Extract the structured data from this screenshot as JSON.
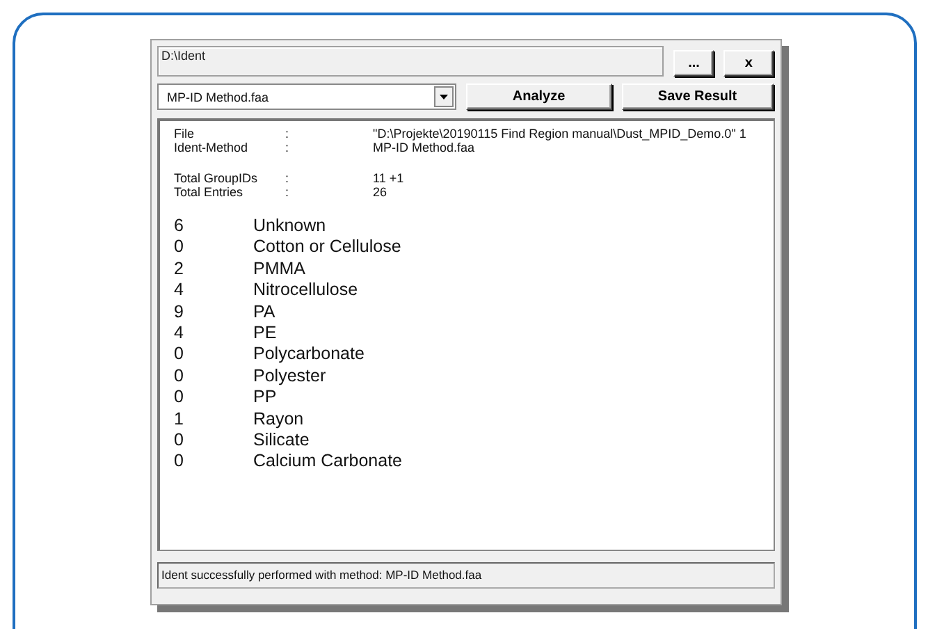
{
  "path_field": {
    "value": "D:\\Ident"
  },
  "browse_button": "...",
  "close_button": "x",
  "method_select": {
    "value": "MP-ID Method.faa"
  },
  "buttons": [
    "Analyze",
    "Save Result"
  ],
  "info": [
    {
      "label": "File",
      "separator": ":",
      "value": "\"D:\\Projekte\\20190115 Find Region manual\\Dust_MPID_Demo.0\" 1"
    },
    {
      "label": "Ident-Method",
      "separator": ":",
      "value": "MP-ID Method.faa"
    }
  ],
  "totals": [
    {
      "label": "Total GroupIDs",
      "separator": ":",
      "value": "11 +1"
    },
    {
      "label": "Total Entries",
      "separator": ":",
      "value": "26"
    }
  ],
  "results": [
    {
      "count": "6",
      "name": "Unknown"
    },
    {
      "count": "0",
      "name": "Cotton or Cellulose"
    },
    {
      "count": "2",
      "name": "PMMA"
    },
    {
      "count": "4",
      "name": "Nitrocellulose"
    },
    {
      "count": "9",
      "name": "PA"
    },
    {
      "count": "4",
      "name": "PE"
    },
    {
      "count": "0",
      "name": "Polycarbonate"
    },
    {
      "count": "0",
      "name": "Polyester"
    },
    {
      "count": "0",
      "name": "PP"
    },
    {
      "count": "1",
      "name": "Rayon"
    },
    {
      "count": "0",
      "name": "Silicate"
    },
    {
      "count": "0",
      "name": "Calcium Carbonate"
    }
  ],
  "status_bar": "Ident successfully performed with method: MP-ID Method.faa"
}
